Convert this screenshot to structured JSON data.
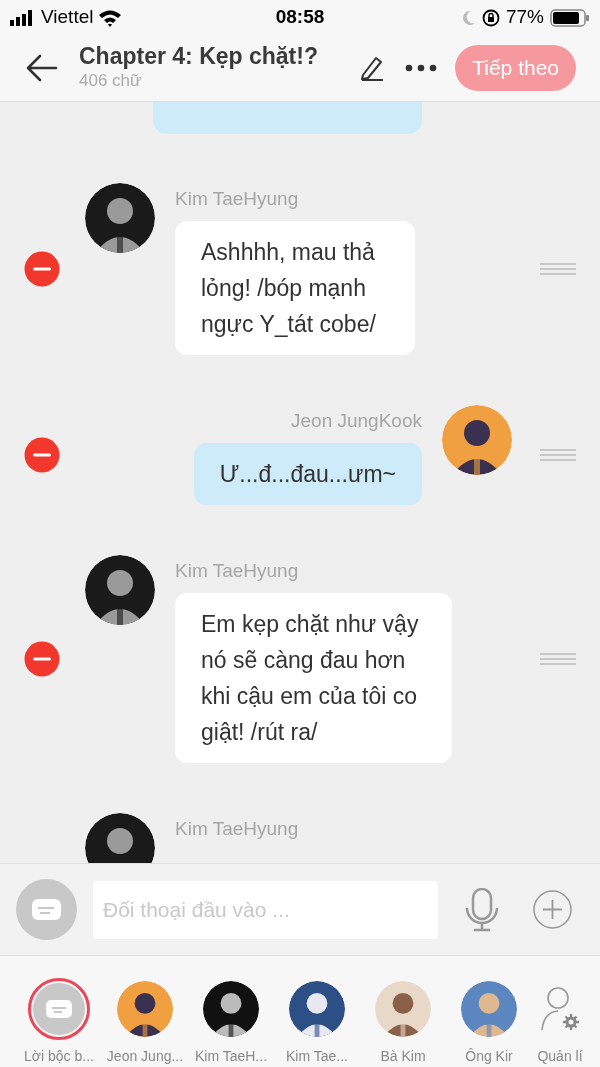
{
  "status_bar": {
    "carrier": "Viettel",
    "time": "08:58",
    "battery": "77%"
  },
  "header": {
    "title": "Chapter 4: Kẹp chặt!?",
    "subtitle": "406 chữ",
    "next_button": "Tiếp theo"
  },
  "messages": [
    {
      "kind": "incoming",
      "name": "Kim TaeHyung",
      "text": "Ashhhh, mau thả lỏng! /bóp mạnh ngực Y_tát cobe/"
    },
    {
      "kind": "outgoing",
      "name": "Jeon JungKook",
      "text": "Ư...đ...đau...ưm~"
    },
    {
      "kind": "incoming",
      "name": "Kim TaeHyung",
      "text": "Em kẹp chặt như vậy nó sẽ càng đau hơn khi cậu em của tôi co giật! /rút ra/"
    },
    {
      "kind": "incoming",
      "name": "Kim TaeHyung"
    }
  ],
  "input": {
    "placeholder": "Đối thoại đầu vào ..."
  },
  "characters": [
    {
      "kind": "narrator",
      "label": "Lời bộc b...",
      "selected": true
    },
    {
      "kind": "character",
      "label": "Jeon Jung...",
      "selected": false
    },
    {
      "kind": "character",
      "label": "Kim TaeH...",
      "selected": false
    },
    {
      "kind": "character",
      "label": "Kim Tae...",
      "selected": false
    },
    {
      "kind": "character",
      "label": "Bà Kim",
      "selected": false
    },
    {
      "kind": "character",
      "label": "Ông Kir",
      "selected": false
    },
    {
      "kind": "manage",
      "label": "Quản lí"
    }
  ]
}
